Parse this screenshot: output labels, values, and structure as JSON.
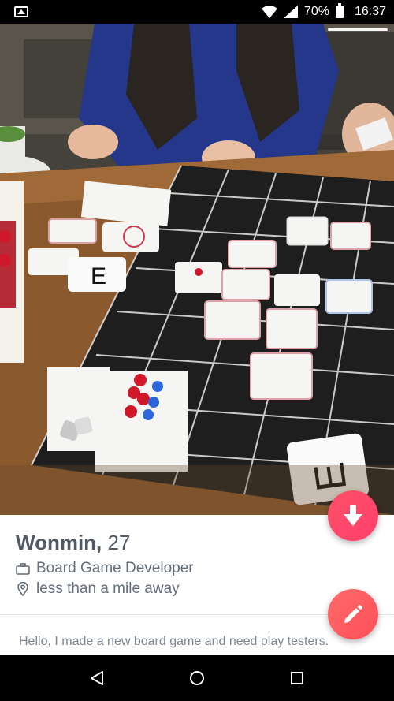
{
  "status_bar": {
    "battery_percent": "70%",
    "time": "16:37",
    "icons": [
      "gallery-notification-icon",
      "wifi-icon",
      "signal-icon",
      "battery-icon"
    ]
  },
  "photo": {
    "description_icon": "board-game-photo",
    "pager_count": 1
  },
  "profile": {
    "name": "Wonmin,",
    "age": "27",
    "job": "Board Game Developer",
    "job_icon": "briefcase-icon",
    "distance": "less than a mile away",
    "distance_icon": "location-pin-icon",
    "bio": "Hello, I made a new board game and need play testers."
  },
  "actions": {
    "collapse_icon": "arrow-down-icon",
    "edit_icon": "pencil-icon"
  },
  "colors": {
    "accent": "#fd5068",
    "name_text": "#505965",
    "meta_text": "#656e7b"
  },
  "navbar": {
    "icons": [
      "back-icon",
      "home-icon",
      "recents-icon"
    ]
  }
}
